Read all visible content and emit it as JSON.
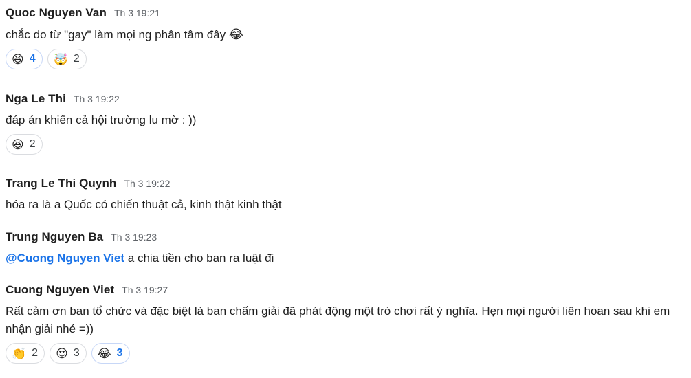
{
  "messages": [
    {
      "sender": "Quoc Nguyen Van",
      "time": "Th 3 19:21",
      "text": "chắc do từ \"gay\" làm mọi ng phân tâm đây",
      "text_emoji": "😂",
      "reactions": [
        {
          "emoji": "😆",
          "count": "4",
          "mine": true
        },
        {
          "emoji": "🤯",
          "count": "2",
          "mine": false
        }
      ]
    },
    {
      "sender": "Nga Le Thi",
      "time": "Th 3 19:22",
      "text": "đáp án khiến cả hội trường lu mờ : ))",
      "reactions": [
        {
          "emoji": "😆",
          "count": "2",
          "mine": false
        }
      ]
    },
    {
      "sender": "Trang Le Thi Quynh",
      "time": "Th 3 19:22",
      "text": "hóa ra là a Quốc có chiến thuật cả, kinh thật kinh thật"
    },
    {
      "sender": "Trung Nguyen Ba",
      "time": "Th 3 19:23",
      "mention": "@Cuong Nguyen Viet",
      "text": " a chia tiền cho ban ra luật đi"
    },
    {
      "sender": "Cuong Nguyen Viet",
      "time": "Th 3 19:27",
      "text": "Rất cảm ơn ban tổ chức và đặc biệt là ban chấm giải đã phát động một trò chơi rất ý nghĩa. Hẹn mọi người liên hoan sau khi em nhận giải nhé =))",
      "reactions": [
        {
          "emoji": "👏",
          "count": "2",
          "mine": false
        },
        {
          "emoji": "😍",
          "count": "3",
          "mine": false
        },
        {
          "emoji": "😂",
          "count": "3",
          "mine": true
        }
      ]
    }
  ]
}
